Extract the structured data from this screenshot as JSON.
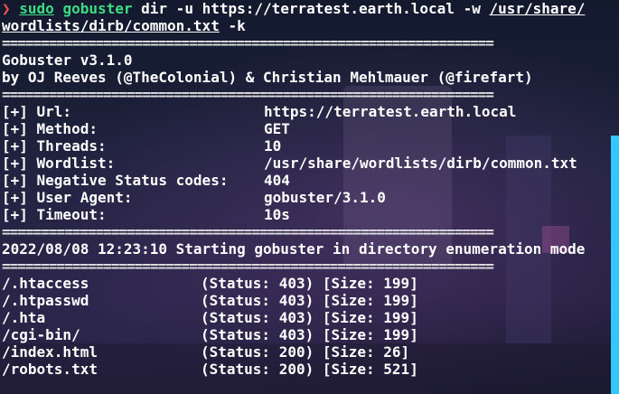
{
  "colors": {
    "prompt": "#ff4d5a",
    "command": "#3ddc84",
    "text": "#ffffff"
  },
  "prompt_symbol": "❯",
  "command": {
    "sudo": "sudo",
    "program": "gobuster",
    "args_part1": " dir -u https://terratest.earth.local -w ",
    "wordlist_line1": "/usr/share/",
    "wordlist_line2": "wordlists/dirb/common.txt",
    "args_part2": " -k"
  },
  "separator": "===============================================================",
  "banner": {
    "version": "Gobuster v3.1.0",
    "authors": "by OJ Reeves (@TheColonial) & Christian Mehlmauer (@firefart)"
  },
  "config": [
    {
      "key": "[+] Url:",
      "value": "https://terratest.earth.local"
    },
    {
      "key": "[+] Method:",
      "value": "GET"
    },
    {
      "key": "[+] Threads:",
      "value": "10"
    },
    {
      "key": "[+] Wordlist:",
      "value": "/usr/share/wordlists/dirb/common.txt"
    },
    {
      "key": "[+] Negative Status codes:",
      "value": "404"
    },
    {
      "key": "[+] User Agent:",
      "value": "gobuster/3.1.0"
    },
    {
      "key": "[+] Timeout:",
      "value": "10s"
    }
  ],
  "start_message": "2022/08/08 12:23:10 Starting gobuster in directory enumeration mode",
  "results": [
    {
      "path": "/.htaccess",
      "status": "(Status: 403) [Size: 199]"
    },
    {
      "path": "/.htpasswd",
      "status": "(Status: 403) [Size: 199]"
    },
    {
      "path": "/.hta",
      "status": "(Status: 403) [Size: 199]"
    },
    {
      "path": "/cgi-bin/",
      "status": "(Status: 403) [Size: 199]"
    },
    {
      "path": "/index.html",
      "status": "(Status: 200) [Size: 26]"
    },
    {
      "path": "/robots.txt",
      "status": "(Status: 200) [Size: 521]"
    }
  ]
}
